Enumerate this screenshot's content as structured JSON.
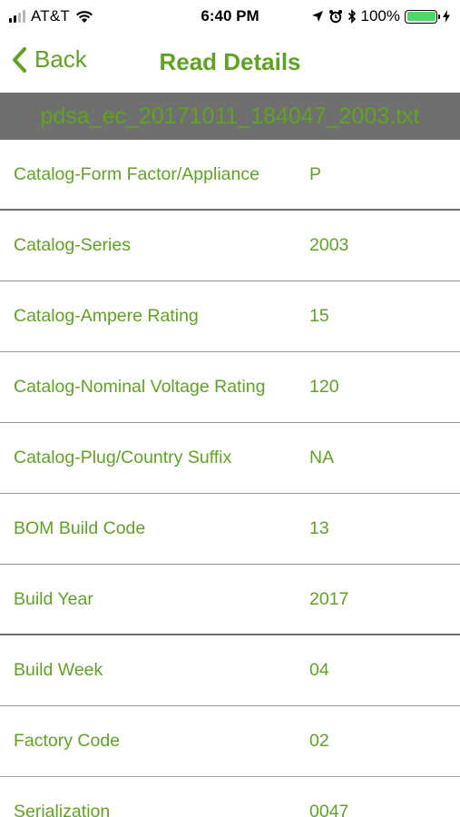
{
  "status_bar": {
    "carrier": "AT&T",
    "time": "6:40 PM",
    "battery_percent": "100%",
    "battery_level": 1.0
  },
  "nav": {
    "back_label": "Back",
    "title": "Read Details"
  },
  "file_name": "pdsa_ec_20171011_184047_2003.txt",
  "colors": {
    "accent": "#5fa323",
    "header_bg": "#6f6f6f",
    "battery": "#4cd964"
  },
  "rows": [
    {
      "label": "Catalog-Form Factor/Appliance",
      "value": "P"
    },
    {
      "label": "Catalog-Series",
      "value": "2003"
    },
    {
      "label": "Catalog-Ampere Rating",
      "value": "15"
    },
    {
      "label": "Catalog-Nominal Voltage Rating",
      "value": "120"
    },
    {
      "label": "Catalog-Plug/Country Suffix",
      "value": "NA"
    },
    {
      "label": "BOM Build Code",
      "value": "13"
    },
    {
      "label": "Build Year",
      "value": "2017"
    },
    {
      "label": "Build Week",
      "value": "04"
    },
    {
      "label": "Factory Code",
      "value": "02"
    },
    {
      "label": "Serialization",
      "value": "0047"
    }
  ]
}
